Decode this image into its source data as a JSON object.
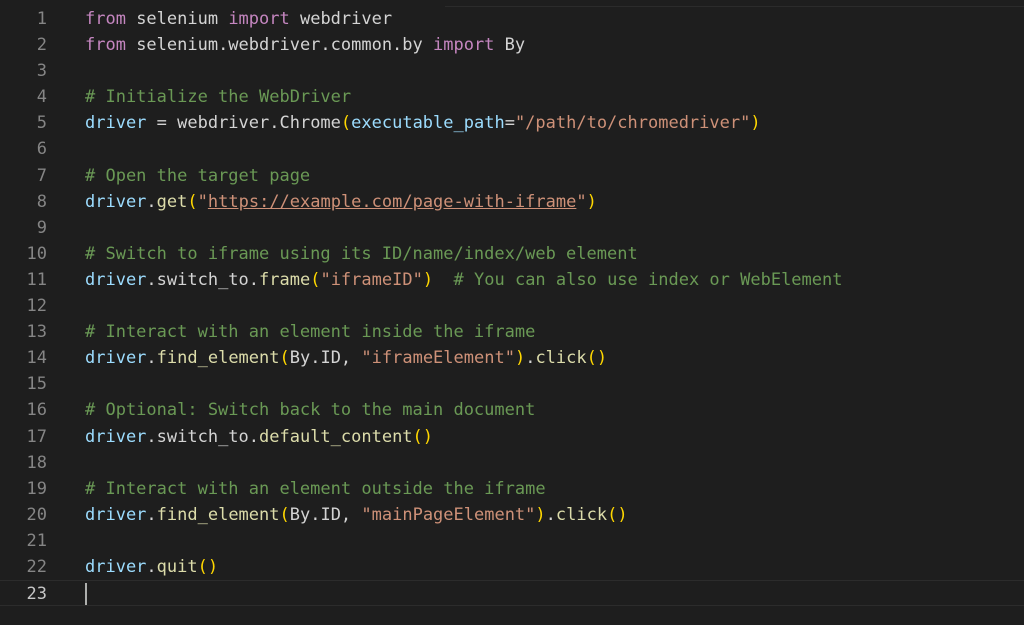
{
  "editor": {
    "cursor_line": 23,
    "lines": [
      {
        "number": "1",
        "tokens": [
          {
            "text": "from",
            "type": "kw"
          },
          {
            "text": " selenium ",
            "type": "plain"
          },
          {
            "text": "import",
            "type": "kw"
          },
          {
            "text": " webdriver",
            "type": "plain"
          }
        ]
      },
      {
        "number": "2",
        "tokens": [
          {
            "text": "from",
            "type": "kw"
          },
          {
            "text": " selenium.webdriver.common.by ",
            "type": "plain"
          },
          {
            "text": "import",
            "type": "kw"
          },
          {
            "text": " By",
            "type": "plain"
          }
        ]
      },
      {
        "number": "3",
        "tokens": []
      },
      {
        "number": "4",
        "tokens": [
          {
            "text": "# Initialize the WebDriver",
            "type": "cmt"
          }
        ]
      },
      {
        "number": "5",
        "tokens": [
          {
            "text": "driver",
            "type": "var"
          },
          {
            "text": " = webdriver.",
            "type": "plain"
          },
          {
            "text": "Chrome",
            "type": "plain"
          },
          {
            "text": "(",
            "type": "p1"
          },
          {
            "text": "executable_path",
            "type": "var"
          },
          {
            "text": "=",
            "type": "plain"
          },
          {
            "text": "\"/path/to/chromedriver\"",
            "type": "str"
          },
          {
            "text": ")",
            "type": "p1"
          }
        ]
      },
      {
        "number": "6",
        "tokens": []
      },
      {
        "number": "7",
        "tokens": [
          {
            "text": "# Open the target page",
            "type": "cmt"
          }
        ]
      },
      {
        "number": "8",
        "tokens": [
          {
            "text": "driver",
            "type": "var"
          },
          {
            "text": ".",
            "type": "plain"
          },
          {
            "text": "get",
            "type": "fn"
          },
          {
            "text": "(",
            "type": "p1"
          },
          {
            "text": "\"",
            "type": "str"
          },
          {
            "text": "https://example.com/page-with-iframe",
            "type": "url"
          },
          {
            "text": "\"",
            "type": "str"
          },
          {
            "text": ")",
            "type": "p1"
          }
        ]
      },
      {
        "number": "9",
        "tokens": []
      },
      {
        "number": "10",
        "tokens": [
          {
            "text": "# Switch to iframe using its ID/name/index/web element",
            "type": "cmt"
          }
        ]
      },
      {
        "number": "11",
        "tokens": [
          {
            "text": "driver",
            "type": "var"
          },
          {
            "text": ".switch_to.",
            "type": "plain"
          },
          {
            "text": "frame",
            "type": "fn"
          },
          {
            "text": "(",
            "type": "p1"
          },
          {
            "text": "\"iframeID\"",
            "type": "str"
          },
          {
            "text": ")",
            "type": "p1"
          },
          {
            "text": "  ",
            "type": "plain"
          },
          {
            "text": "# You can also use index or WebElement",
            "type": "cmt"
          }
        ]
      },
      {
        "number": "12",
        "tokens": []
      },
      {
        "number": "13",
        "tokens": [
          {
            "text": "# Interact with an element inside the iframe",
            "type": "cmt"
          }
        ]
      },
      {
        "number": "14",
        "tokens": [
          {
            "text": "driver",
            "type": "var"
          },
          {
            "text": ".",
            "type": "plain"
          },
          {
            "text": "find_element",
            "type": "fn"
          },
          {
            "text": "(",
            "type": "p1"
          },
          {
            "text": "By.ID, ",
            "type": "plain"
          },
          {
            "text": "\"iframeElement\"",
            "type": "str"
          },
          {
            "text": ")",
            "type": "p1"
          },
          {
            "text": ".",
            "type": "plain"
          },
          {
            "text": "click",
            "type": "fn"
          },
          {
            "text": "()",
            "type": "p1"
          }
        ]
      },
      {
        "number": "15",
        "tokens": []
      },
      {
        "number": "16",
        "tokens": [
          {
            "text": "# Optional: Switch back to the main document",
            "type": "cmt"
          }
        ]
      },
      {
        "number": "17",
        "tokens": [
          {
            "text": "driver",
            "type": "var"
          },
          {
            "text": ".switch_to.",
            "type": "plain"
          },
          {
            "text": "default_content",
            "type": "fn"
          },
          {
            "text": "()",
            "type": "p1"
          }
        ]
      },
      {
        "number": "18",
        "tokens": []
      },
      {
        "number": "19",
        "tokens": [
          {
            "text": "# Interact with an element outside the iframe",
            "type": "cmt"
          }
        ]
      },
      {
        "number": "20",
        "tokens": [
          {
            "text": "driver",
            "type": "var"
          },
          {
            "text": ".",
            "type": "plain"
          },
          {
            "text": "find_element",
            "type": "fn"
          },
          {
            "text": "(",
            "type": "p1"
          },
          {
            "text": "By.ID, ",
            "type": "plain"
          },
          {
            "text": "\"mainPageElement\"",
            "type": "str"
          },
          {
            "text": ")",
            "type": "p1"
          },
          {
            "text": ".",
            "type": "plain"
          },
          {
            "text": "click",
            "type": "fn"
          },
          {
            "text": "()",
            "type": "p1"
          }
        ]
      },
      {
        "number": "21",
        "tokens": []
      },
      {
        "number": "22",
        "tokens": [
          {
            "text": "driver",
            "type": "var"
          },
          {
            "text": ".",
            "type": "plain"
          },
          {
            "text": "quit",
            "type": "fn"
          },
          {
            "text": "()",
            "type": "p1"
          }
        ]
      },
      {
        "number": "23",
        "tokens": []
      }
    ]
  },
  "colors": {
    "background": "#1e1e1e",
    "keyword": "#c586c0",
    "variable": "#9cdcfe",
    "function": "#dcdcaa",
    "string": "#ce9178",
    "comment": "#6a9955",
    "bracket": "#ffd700",
    "line_number": "#858585"
  }
}
